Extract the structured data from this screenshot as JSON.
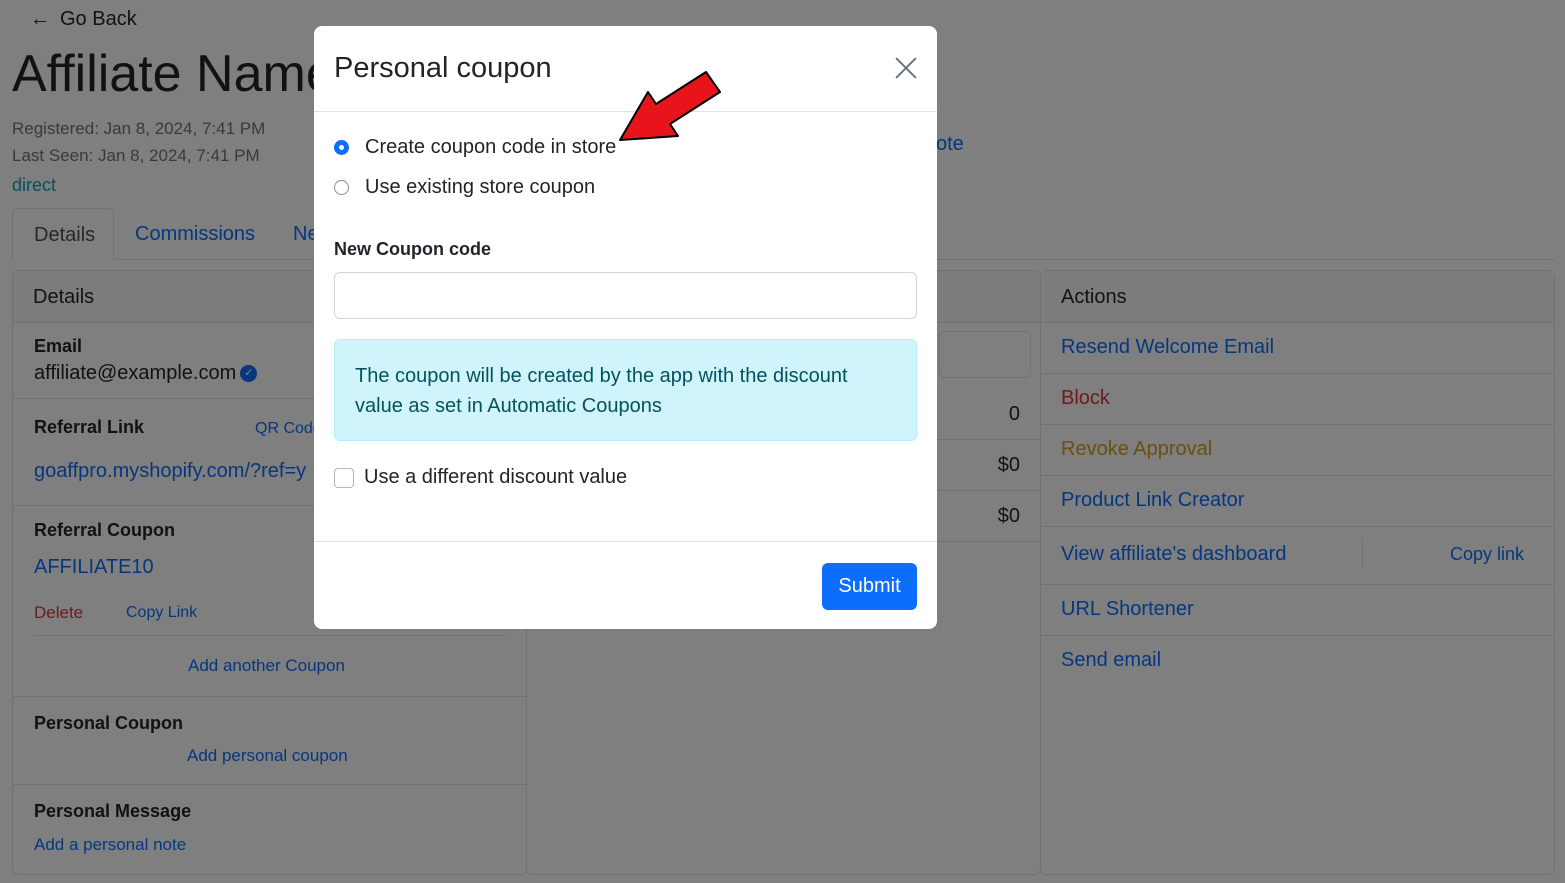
{
  "page": {
    "go_back": "Go Back",
    "title": "Affiliate Name",
    "registered": "Registered: Jan 8, 2024, 7:41 PM",
    "last_seen": "Last Seen: Jan 8, 2024, 7:41 PM",
    "source": "direct",
    "note_link": "ote",
    "tabs": [
      {
        "label": "Details"
      },
      {
        "label": "Commissions"
      },
      {
        "label": "Ne"
      }
    ]
  },
  "details_card": {
    "header": "Details",
    "email_label": "Email",
    "email_value": "affiliate@example.com",
    "referral_link_label": "Referral Link",
    "qr_code": "QR Code",
    "referral_link_value": "goaffpro.myshopify.com/?ref=y",
    "referral_coupon_label": "Referral Coupon",
    "coupon_code": "AFFILIATE10",
    "delete": "Delete",
    "copy_link": "Copy Link",
    "add_another_coupon": "Add another Coupon",
    "personal_coupon_label": "Personal Coupon",
    "add_personal_coupon": "Add personal coupon",
    "personal_message_label": "Personal Message",
    "add_personal_note": "Add a personal note"
  },
  "mid_card": {
    "values": [
      "0",
      "$0",
      "$0"
    ]
  },
  "actions_card": {
    "header": "Actions",
    "resend": "Resend Welcome Email",
    "block": "Block",
    "revoke": "Revoke Approval",
    "product_link": "Product Link Creator",
    "dashboard": "View affiliate's dashboard",
    "copy_link": "Copy link",
    "url_shortener": "URL Shortener",
    "send_email": "Send email"
  },
  "modal": {
    "title": "Personal coupon",
    "option_create": "Create coupon code in store",
    "option_existing": "Use existing store coupon",
    "selected_option": "create",
    "field_label": "New Coupon code",
    "field_value": "",
    "info_text": "The coupon will be created by the app with the discount value as set in Automatic Coupons",
    "different_discount": "Use a different discount value",
    "different_discount_checked": false,
    "submit": "Submit"
  },
  "colors": {
    "primary": "#0d6efd",
    "danger": "#dc3545",
    "warning": "#ffc107",
    "info_bg": "#cff4fc",
    "annotation_arrow": "#e8141c"
  }
}
